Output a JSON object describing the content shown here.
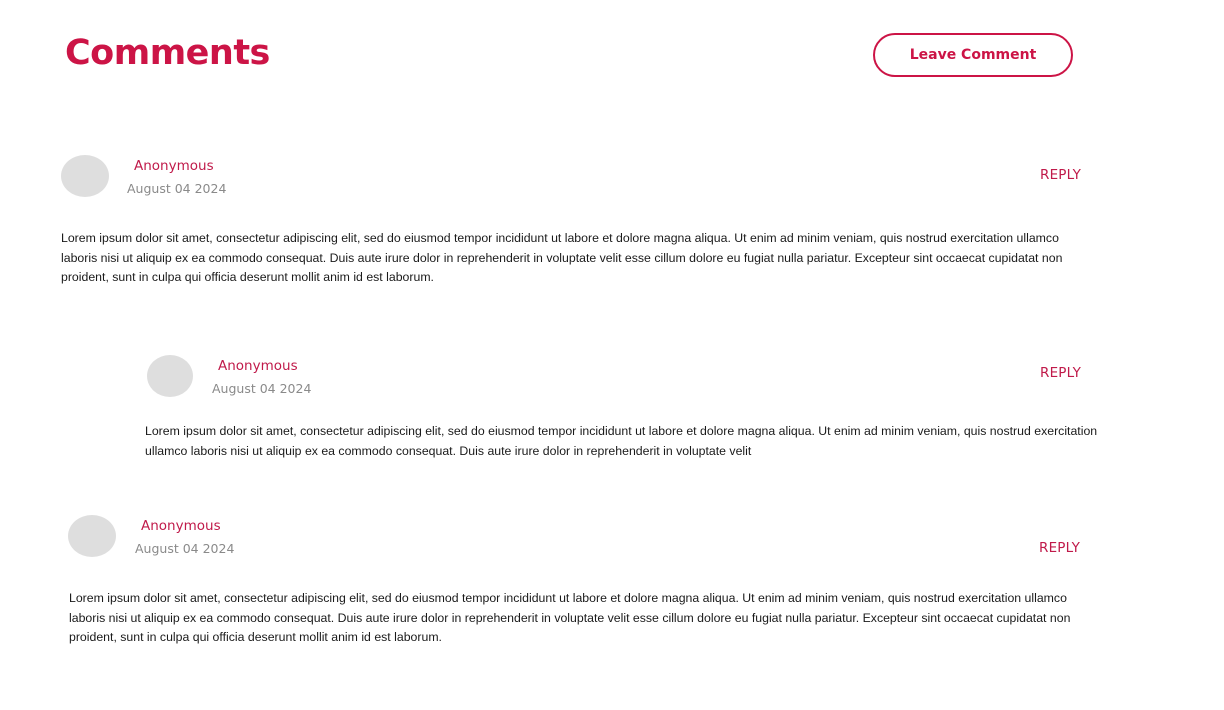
{
  "header": {
    "title": "Comments",
    "leave_comment_label": "Leave Comment"
  },
  "colors": {
    "accent": "#cc1446",
    "avatar_placeholder": "#dedede",
    "date_text": "#8a8a8a"
  },
  "comments": [
    {
      "author": "Anonymous",
      "date": "August 04 2024",
      "reply_label": "REPLY",
      "body": "Lorem ipsum dolor sit amet, consectetur adipiscing elit, sed do eiusmod tempor incididunt ut labore et dolore magna aliqua. Ut enim ad minim veniam, quis nostrud exercitation ullamco laboris nisi ut aliquip ex ea commodo consequat. Duis aute irure dolor in reprehenderit in voluptate velit esse cillum dolore eu fugiat nulla pariatur. Excepteur sint occaecat cupidatat non proident, sunt in culpa qui officia deserunt mollit anim id est laborum.",
      "is_reply": false
    },
    {
      "author": "Anonymous",
      "date": "August 04 2024",
      "reply_label": "REPLY",
      "body": "Lorem ipsum dolor sit amet, consectetur adipiscing elit, sed do eiusmod tempor incididunt ut labore et dolore magna aliqua. Ut enim ad minim veniam, quis nostrud exercitation ullamco laboris nisi ut aliquip ex ea commodo consequat. Duis aute irure dolor in reprehenderit in voluptate velit",
      "is_reply": true
    },
    {
      "author": "Anonymous",
      "date": "August 04 2024",
      "reply_label": "REPLY",
      "body": "Lorem ipsum dolor sit amet, consectetur adipiscing elit, sed do eiusmod tempor incididunt ut labore et dolore magna aliqua. Ut enim ad minim veniam, quis nostrud exercitation ullamco laboris nisi ut aliquip ex ea commodo consequat. Duis aute irure dolor in reprehenderit in voluptate velit esse cillum dolore eu fugiat nulla pariatur. Excepteur sint occaecat cupidatat non proident, sunt in culpa qui officia deserunt mollit anim id est laborum.",
      "is_reply": false
    }
  ]
}
